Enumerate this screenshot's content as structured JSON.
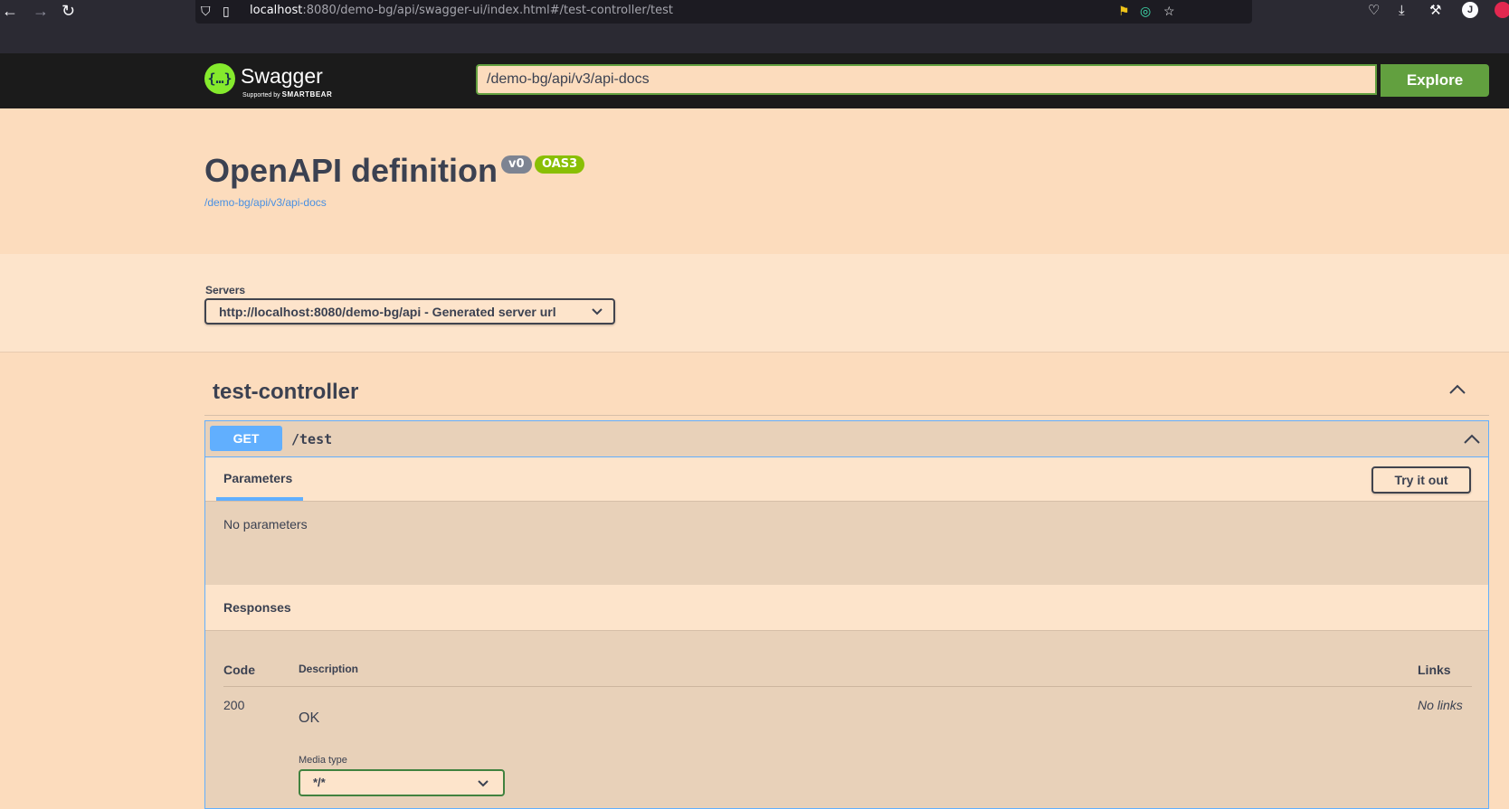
{
  "browser": {
    "url_host": "localhost",
    "url_rest": ":8080/demo-bg/api/swagger-ui/index.html#/test-controller/test",
    "avatar_letter": "J"
  },
  "swagger": {
    "logo_name": "Swagger",
    "logo_sub_prefix": "Supported by",
    "logo_sub_brand": "SMARTBEAR",
    "explore_value": "/demo-bg/api/v3/api-docs",
    "explore_label": "Explore"
  },
  "info": {
    "title": "OpenAPI definition",
    "version_badge": "v0",
    "oas_badge": "OAS3",
    "spec_link": "/demo-bg/api/v3/api-docs"
  },
  "servers": {
    "label": "Servers",
    "selected": "http://localhost:8080/demo-bg/api - Generated server url"
  },
  "tag": {
    "name": "test-controller",
    "operation": {
      "method": "GET",
      "path": "/test",
      "parameters_title": "Parameters",
      "try_label": "Try it out",
      "no_params": "No parameters",
      "responses_title": "Responses",
      "columns": {
        "code": "Code",
        "description": "Description",
        "links": "Links"
      },
      "responses": [
        {
          "code": "200",
          "description": "OK",
          "links": "No links",
          "media_label": "Media type",
          "media_type": "*/*"
        }
      ]
    }
  },
  "colors": {
    "background": "#fcdcbd",
    "topbar": "#1b1b1b",
    "accent_green": "#62a03f",
    "get_blue": "#61affe"
  }
}
